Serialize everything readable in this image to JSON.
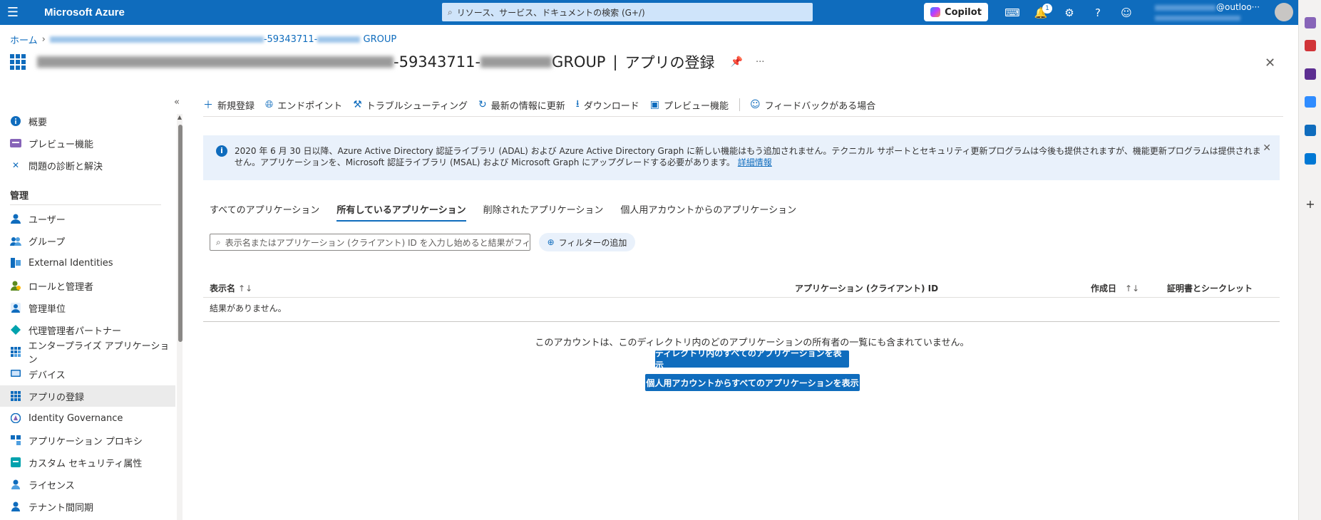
{
  "topbar": {
    "brand": "Microsoft Azure",
    "search_placeholder": "リソース、サービス、ドキュメントの検索 (G+/)",
    "copilot_label": "Copilot",
    "notification_count": "1",
    "account_email_suffix": "@outloo···"
  },
  "breadcrumb": {
    "home": "ホーム",
    "tenant_suffix_1": "-59343711-",
    "tenant_suffix_2": " GROUP"
  },
  "header": {
    "title_mid": "-59343711-",
    "title_end": " GROUP",
    "separator": "|",
    "blade": "アプリの登録",
    "more": "···"
  },
  "sidebar": {
    "items": [
      {
        "label": "概要",
        "icon": "info-icon",
        "color": "#0f6cbd"
      },
      {
        "label": "プレビュー機能",
        "icon": "preview-icon",
        "color": "#8764b8"
      },
      {
        "label": "問題の診断と解決",
        "icon": "wrench-icon",
        "color": "#0f6cbd"
      }
    ],
    "section_title": "管理",
    "manage_items": [
      {
        "label": "ユーザー",
        "icon": "user-icon",
        "color": "#0f6cbd"
      },
      {
        "label": "グループ",
        "icon": "group-icon",
        "color": "#0f6cbd"
      },
      {
        "label": "External Identities",
        "icon": "external-identities-icon",
        "color": "#0f6cbd"
      },
      {
        "label": "ロールと管理者",
        "icon": "roles-icon",
        "color": "#5c8a1f"
      },
      {
        "label": "管理単位",
        "icon": "admin-unit-icon",
        "color": "#0f6cbd"
      },
      {
        "label": "代理管理者パートナー",
        "icon": "partner-icon",
        "color": "#00a2ad"
      },
      {
        "label": "エンタープライズ アプリケーション",
        "icon": "enterprise-apps-icon",
        "color": "#0f6cbd"
      },
      {
        "label": "デバイス",
        "icon": "device-icon",
        "color": "#0f6cbd"
      },
      {
        "label": "アプリの登録",
        "icon": "app-registrations-icon",
        "color": "#0f6cbd"
      },
      {
        "label": "Identity Governance",
        "icon": "identity-governance-icon",
        "color": "#0f6cbd"
      },
      {
        "label": "アプリケーション プロキシ",
        "icon": "app-proxy-icon",
        "color": "#0f6cbd"
      },
      {
        "label": "カスタム セキュリティ属性",
        "icon": "custom-security-icon",
        "color": "#00a2ad"
      },
      {
        "label": "ライセンス",
        "icon": "license-icon",
        "color": "#0f6cbd"
      },
      {
        "label": "テナント間同期",
        "icon": "cross-tenant-sync-icon",
        "color": "#0f6cbd"
      }
    ]
  },
  "toolbar": {
    "new_registration": "新規登録",
    "endpoints": "エンドポイント",
    "troubleshooting": "トラブルシューティング",
    "refresh": "最新の情報に更新",
    "download": "ダウンロード",
    "preview_features": "プレビュー機能",
    "feedback": "フィードバックがある場合"
  },
  "infobar": {
    "message": "2020 年 6 月 30 日以降、Azure Active Directory 認証ライブラリ (ADAL) および Azure Active Directory Graph に新しい機能はもう追加されません。テクニカル サポートとセキュリティ更新プログラムは今後も提供されますが、機能更新プログラムは提供されません。アプリケーションを、Microsoft 認証ライブラリ (MSAL) および Microsoft Graph にアップグレードする必要があります。",
    "link": "詳細情報"
  },
  "tabs": [
    {
      "label": "すべてのアプリケーション",
      "active": false
    },
    {
      "label": "所有しているアプリケーション",
      "active": true
    },
    {
      "label": "削除されたアプリケーション",
      "active": false
    },
    {
      "label": "個人用アカウントからのアプリケーション",
      "active": false
    }
  ],
  "filter": {
    "placeholder": "表示名またはアプリケーション (クライアント) ID を入力し始めると結果がフィ···",
    "add_filter": "フィルターの追加"
  },
  "table": {
    "columns": [
      "表示名",
      "アプリケーション (クライアント) ID",
      "作成日",
      "証明書とシークレット"
    ],
    "no_results": "結果がありません。"
  },
  "empty_state": {
    "message": "このアカウントは、このディレクトリ内のどのアプリケーションの所有者の一覧にも含まれていません。",
    "button_directory": "ディレクトリ内のすべてのアプリケーションを表示",
    "button_personal": "個人用アカウントからすべてのアプリケーションを表示"
  }
}
